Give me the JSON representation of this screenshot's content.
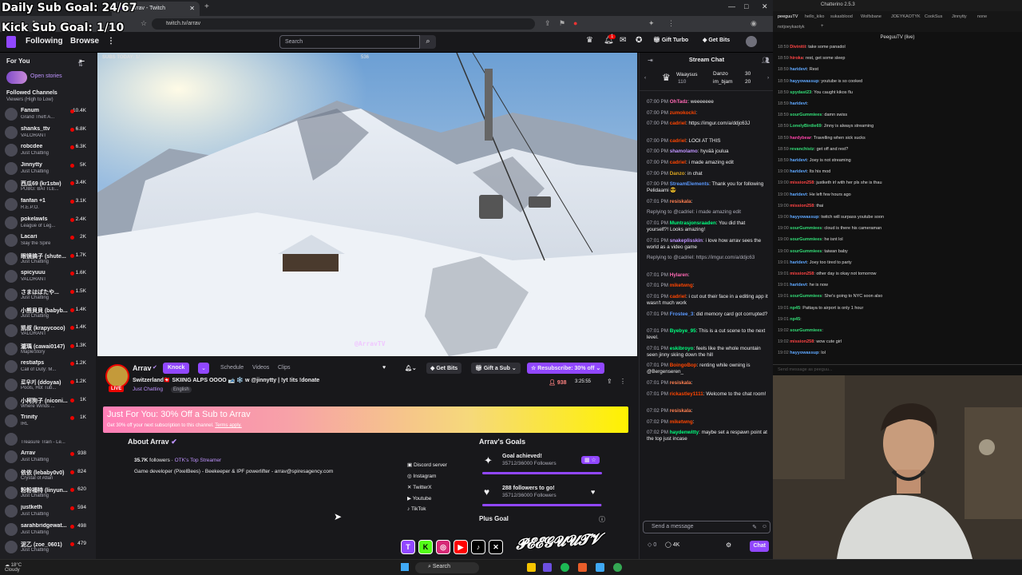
{
  "overlay": {
    "sub_goal": "Daily Sub Goal: 24/67",
    "kick_goal": "Kick Sub Goal: 1/10"
  },
  "browser": {
    "tab_title": "(1) Arrav - Twitch",
    "url": "twitch.tv/arrav"
  },
  "twitch_nav": {
    "following": "Following",
    "browse": "Browse",
    "search_placeholder": "Search",
    "gift_turbo": "Gift Turbo",
    "get_bits": "Get Bits",
    "notif_count": "1"
  },
  "sidebar": {
    "for_you": "For You",
    "open_stories": "Open stories",
    "followed_channels": "Followed Channels",
    "sort_label": "Viewers (High to Low)",
    "channels": [
      {
        "name": "Fanum",
        "game": "Grand Theft A...",
        "viewers": "10.4K"
      },
      {
        "name": "shanks_ttv",
        "game": "VALORANT",
        "viewers": "6.8K"
      },
      {
        "name": "robcdee",
        "game": "Just Chatting",
        "viewers": "6.3K"
      },
      {
        "name": "Jinnytty",
        "game": "Just Chatting",
        "viewers": "5K"
      },
      {
        "name": "西瓜69 (kr1stw)",
        "game": "PUBG: BATTLE...",
        "viewers": "3.4K"
      },
      {
        "name": "fanfan +1",
        "game": "R.E.P.O.",
        "viewers": "3.1K"
      },
      {
        "name": "pokelawls",
        "game": "League of Leg...",
        "viewers": "2.4K"
      },
      {
        "name": "Lacari",
        "game": "Slay the Spire",
        "viewers": "2K"
      },
      {
        "name": "眼镜搞子 (shute...",
        "game": "Just Chatting",
        "viewers": "1.7K"
      },
      {
        "name": "spicyuuu",
        "game": "VALORANT",
        "viewers": "1.6K"
      },
      {
        "name": "さまはばたや...",
        "game": "Just Chatting",
        "viewers": "1.5K"
      },
      {
        "name": "小熊貝貝 (babyb...",
        "game": "Just Chatting",
        "viewers": "1.4K"
      },
      {
        "name": "凯叔 (krapycoco)",
        "game": "VALORANT",
        "viewers": "1.4K"
      },
      {
        "name": "瀧瑀 (cawai0147)",
        "game": "MapleStory",
        "viewers": "1.3K"
      },
      {
        "name": "restiafps",
        "game": "Call of Duty: M...",
        "viewers": "1.2K"
      },
      {
        "name": "로우키 (ddoyaa)",
        "game": "Pools, Hot Tub...",
        "viewers": "1.2K"
      },
      {
        "name": "小柯狗子 (niconi...",
        "game": "Where Winds ...",
        "viewers": "1K"
      },
      {
        "name": "Trinity",
        "game": "IRL",
        "viewers": "1K"
      },
      {
        "name": "",
        "game": "Treasure Train - Le...",
        "viewers": ""
      },
      {
        "name": "Arrav",
        "game": "Just Chatting",
        "viewers": "938"
      },
      {
        "name": "依依 (lebaby0v0)",
        "game": "Crystal of Atlan",
        "viewers": "824"
      },
      {
        "name": "粉粉福特 (linyun...",
        "game": "Just Chatting",
        "viewers": "620"
      },
      {
        "name": "justketh",
        "game": "Just Chatting",
        "viewers": "594"
      },
      {
        "name": "sarahbridgewat...",
        "game": "Just Chatting",
        "viewers": "498"
      },
      {
        "name": "泥乙 (zoe_0601)",
        "game": "Just Chatting",
        "viewers": "479"
      },
      {
        "name": "Dans.Live...",
        "game": "",
        "viewers": ""
      }
    ]
  },
  "video": {
    "subs_today": "SUBS TODAY: 1/",
    "top_num": "536",
    "watermark": "@ArravTV"
  },
  "stream": {
    "streamer": "Arrav",
    "knock_label": "Knock",
    "schedule": "Schedule",
    "videos": "Videos",
    "clips": "Clips",
    "title": "Switzerland🇨🇭 SKIING ALPS OOOO 🎿 ❄️ w @jinnytty | !yt !its !donate",
    "category": "Just Chatting",
    "language": "English",
    "live": "LIVE",
    "get_bits": "Get Bits",
    "gift_sub": "Gift a Sub",
    "resubscribe": "Resubscribe: 30% off",
    "viewers": "938",
    "uptime": "3:25:55"
  },
  "banner": {
    "headline": "Just For You: 30% Off a Sub to Arrav",
    "sub": "Get 30% off your next subscription to this channel.",
    "terms": "Terms apply."
  },
  "about": {
    "title": "About Arrav",
    "followers": "35.7K",
    "followers_suffix": "followers ·",
    "team": "OTK's Top Streamer",
    "bio": "Game developer (PixelBees) - Beekeeper & IPF powerlifter - arrav@spiresagency.com",
    "links": [
      "Discord server",
      "Instagram",
      "TwitterX",
      "Youtube",
      "TikTok"
    ]
  },
  "goals": {
    "title": "Arrav's Goals",
    "g1_title": "Goal achieved!",
    "g1_sub": "17/14 New Subs",
    "g1_progress": 1.0,
    "g2_title": "288 followers to go!",
    "g2_sub": "35712/36000 Followers",
    "g2_progress": 0.992,
    "plus_goal": "Plus Goal"
  },
  "chat": {
    "header": "Stream Chat",
    "hype_user": "Waaysus",
    "hype_count": "110",
    "rank1": "Danzo",
    "rank1_val": "30",
    "rank2": "im_bjam",
    "rank2_val": "20",
    "messages": [
      {
        "t": "07:00 PM",
        "u": "OhTadz",
        "c": "#ff69b4",
        "m": ": weeeeeee"
      },
      {
        "t": "07:00 PM",
        "u": "zumokocki",
        "c": "#ff4500",
        "m": ":"
      },
      {
        "t": "07:00 PM",
        "u": "cadriel",
        "c": "#ff4500",
        "m": ": https://imgur.com/a/ddjc63J"
      },
      {
        "t": "07:00 PM",
        "u": "cadriel",
        "c": "#ff4500",
        "m": ": LOOI AT THIS"
      },
      {
        "t": "07:00 PM",
        "u": "shamolamo",
        "c": "#bf94ff",
        "m": ": hyvää joulua"
      },
      {
        "t": "07:00 PM",
        "u": "cadriel",
        "c": "#ff4500",
        "m": ": i made amazing edit"
      },
      {
        "t": "07:00 PM",
        "u": "Danzo",
        "c": "#daa520",
        "m": ": in chat"
      },
      {
        "t": "07:00 PM",
        "u": "StreamElements",
        "c": "#5b99ff",
        "m": ": Thank you for following Pelidaami 😎"
      },
      {
        "t": "07:01 PM",
        "u": "resiskala",
        "c": "#ff7f50",
        "m": ":"
      },
      {
        "t": "",
        "u": "",
        "c": "#adadb8",
        "m": "Replying to @cadriel: i made amazing edit"
      },
      {
        "t": "07:01 PM",
        "u": "Muntrasjonsraaden",
        "c": "#00ff7f",
        "m": ": You did that yourself?! Looks amazing!"
      },
      {
        "t": "07:01 PM",
        "u": "snakeplisskin",
        "c": "#bf94ff",
        "m": ": i love how arrav sees the world as a video game"
      },
      {
        "t": "",
        "u": "",
        "c": "#adadb8",
        "m": "Replying to @cadriel: https://imgur.com/a/ddjc63"
      },
      {
        "t": "07:01 PM",
        "u": "Hylaren",
        "c": "#ff69b4",
        "m": ":"
      },
      {
        "t": "07:01 PM",
        "u": "miketwng",
        "c": "#ff4500",
        "m": ":"
      },
      {
        "t": "07:01 PM",
        "u": "cadriel",
        "c": "#ff4500",
        "m": ": i cut out their face in a editing app it wasn't much work"
      },
      {
        "t": "07:01 PM",
        "u": "Frostee_3",
        "c": "#5b99ff",
        "m": ": did memory card got corrupted?"
      },
      {
        "t": "07:01 PM",
        "u": "Byebye_95",
        "c": "#00ff7f",
        "m": ": This is a cut scene to the next level."
      },
      {
        "t": "07:01 PM",
        "u": "eskibroyo",
        "c": "#00ff7f",
        "m": ": feels like the whole mountain seen jinny skiing down the hill"
      },
      {
        "t": "07:01 PM",
        "u": "BoingoBop",
        "c": "#ff4500",
        "m": ": renting while owning is @Bergenseren_"
      },
      {
        "t": "07:01 PM",
        "u": "resiskala",
        "c": "#ff7f50",
        "m": ":"
      },
      {
        "t": "07:01 PM",
        "u": "rickastley1111",
        "c": "#ff4500",
        "m": ": Welcome to the chat room!"
      },
      {
        "t": "07:02 PM",
        "u": "resiskala",
        "c": "#ff7f50",
        "m": ":"
      },
      {
        "t": "07:02 PM",
        "u": "miketwng",
        "c": "#ff4500",
        "m": ":"
      },
      {
        "t": "07:02 PM",
        "u": "haydenwitty",
        "c": "#00ff7f",
        "m": ": maybe set a respawn point at the top just incase"
      }
    ],
    "input_placeholder": "Send a message",
    "points": "4K",
    "chat_button": "Chat"
  },
  "chatterino": {
    "title": "Chatterino 2.5.3",
    "tabs": [
      "peeguuTV",
      "hello_kiko",
      "sukasblood",
      "Wolfsbane",
      "JOEYKAOTYK",
      "CookSus",
      "Jinnytty",
      "none"
    ],
    "tab2": "notjoeykaotyk",
    "channel": "PeeguuTV (live)",
    "messages": [
      {
        "t": "18:59",
        "u": "Divinitii",
        "c": "#ff4444",
        "m": ": take some panadol"
      },
      {
        "t": "18:59",
        "u": "hiroka",
        "c": "#ff4444",
        "m": ": rest, get some sleep"
      },
      {
        "t": "18:59",
        "u": "haridevt",
        "c": "#5fa8ff",
        "m": ": Rest"
      },
      {
        "t": "18:59",
        "u": "hayyowassup",
        "c": "#5fa8ff",
        "m": ": youtube is so cooked"
      },
      {
        "t": "18:59",
        "u": "spydast23",
        "c": "#33dd77",
        "m": ": You caught kikos flu"
      },
      {
        "t": "18:59",
        "u": "haridevt",
        "c": "#5fa8ff",
        "m": ":"
      },
      {
        "t": "18:59",
        "u": "sourGummiees",
        "c": "#33dd77",
        "m": ": damn swiss"
      },
      {
        "t": "18:59",
        "u": "LonelyBirdie69",
        "c": "#33dd77",
        "m": ": Jinny is always streaming"
      },
      {
        "t": "18:59",
        "u": "hardybear",
        "c": "#ff44aa",
        "m": ": Travelling when sick sucks"
      },
      {
        "t": "18:59",
        "u": "revanchistz",
        "c": "#33dd77",
        "m": ": get off and rest?"
      },
      {
        "t": "18:59",
        "u": "haridevt",
        "c": "#5fa8ff",
        "m": ": Joey is not streaming"
      },
      {
        "t": "19:00",
        "u": "haridevt",
        "c": "#5fa8ff",
        "m": ": Its his mod"
      },
      {
        "t": "19:00",
        "u": "mission258",
        "c": "#ff4444",
        "m": ": justketh irl with her pls she is thau"
      },
      {
        "t": "19:00",
        "u": "haridevt",
        "c": "#5fa8ff",
        "m": ": He left few hours ago"
      },
      {
        "t": "19:00",
        "u": "mission258",
        "c": "#ff4444",
        "m": ": thai"
      },
      {
        "t": "19:00",
        "u": "hayyowassup",
        "c": "#5fa8ff",
        "m": ": twitch will surpass youtube soon"
      },
      {
        "t": "19:00",
        "u": "sourGummiees",
        "c": "#33dd77",
        "m": ": cloud is there his cameraman"
      },
      {
        "t": "19:00",
        "u": "sourGummiees",
        "c": "#33dd77",
        "m": ": he isnt lol"
      },
      {
        "t": "19:00",
        "u": "sourGummiees",
        "c": "#33dd77",
        "m": ": taiwan baby"
      },
      {
        "t": "19:01",
        "u": "haridevt",
        "c": "#5fa8ff",
        "m": ": Joey too tired to party"
      },
      {
        "t": "19:01",
        "u": "mission258",
        "c": "#ff4444",
        "m": ": other day is okay not tomorrow"
      },
      {
        "t": "19:01",
        "u": "haridevt",
        "c": "#5fa8ff",
        "m": ": he is     now"
      },
      {
        "t": "19:01",
        "u": "sourGummiees",
        "c": "#33dd77",
        "m": ": She's going to NYC soon also"
      },
      {
        "t": "19:01",
        "u": "np45",
        "c": "#33dd77",
        "m": ": Pattaya to airport is only 1 hour"
      },
      {
        "t": "19:01",
        "u": "np45",
        "c": "#33dd77",
        "m": ":"
      },
      {
        "t": "19:02",
        "u": "sourGummiees",
        "c": "#33dd77",
        "m": ":"
      },
      {
        "t": "19:02",
        "u": "mission258",
        "c": "#ff4444",
        "m": ": wow cute girl"
      },
      {
        "t": "19:02",
        "u": "hayyowassup",
        "c": "#5fa8ff",
        "m": ": lol"
      }
    ],
    "input_placeholder": "Send message as peeguu..."
  },
  "taskbar": {
    "temp": "18°C",
    "weather": "Cloudy",
    "search": "Search"
  },
  "socials": {
    "signature": "PEEGUUTV"
  },
  "colors": {
    "accent": "#9147ff",
    "live": "#eb0400"
  }
}
